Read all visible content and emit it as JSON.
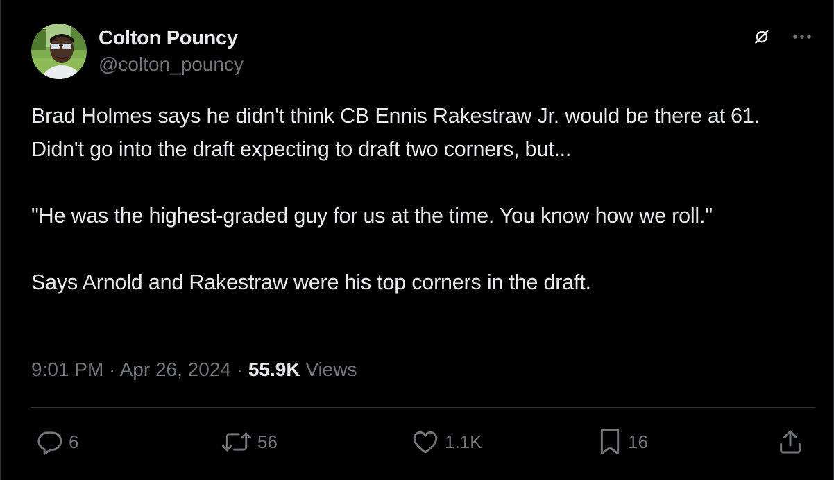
{
  "author": {
    "display_name": "Colton Pouncy",
    "handle": "@colton_pouncy",
    "avatar_icon": "avatar-photo"
  },
  "top_actions": {
    "grok_icon": "grok-icon",
    "more_icon": "more-dots-icon"
  },
  "body": {
    "paragraphs": [
      "Brad Holmes says he didn't think CB Ennis Rakestraw Jr. would be there at 61. Didn't go into the draft expecting to draft two corners, but...",
      "\"He was the highest-graded guy for us at the time. You know how we roll.\"",
      "Says Arnold and Rakestraw were his top corners in the draft."
    ]
  },
  "meta": {
    "time": "9:01 PM",
    "separator": " · ",
    "date": "Apr 26, 2024",
    "views_count": "55.9K",
    "views_label": " Views"
  },
  "actions": {
    "reply": {
      "icon": "reply-icon",
      "count": "6"
    },
    "retweet": {
      "icon": "retweet-icon",
      "count": "56"
    },
    "like": {
      "icon": "heart-icon",
      "count": "1.1K"
    },
    "bookmark": {
      "icon": "bookmark-icon",
      "count": "16"
    },
    "share": {
      "icon": "share-icon"
    }
  },
  "colors": {
    "background": "#000000",
    "text_primary": "#e7e9ea",
    "text_secondary": "#71767b",
    "border": "#2f3336"
  }
}
